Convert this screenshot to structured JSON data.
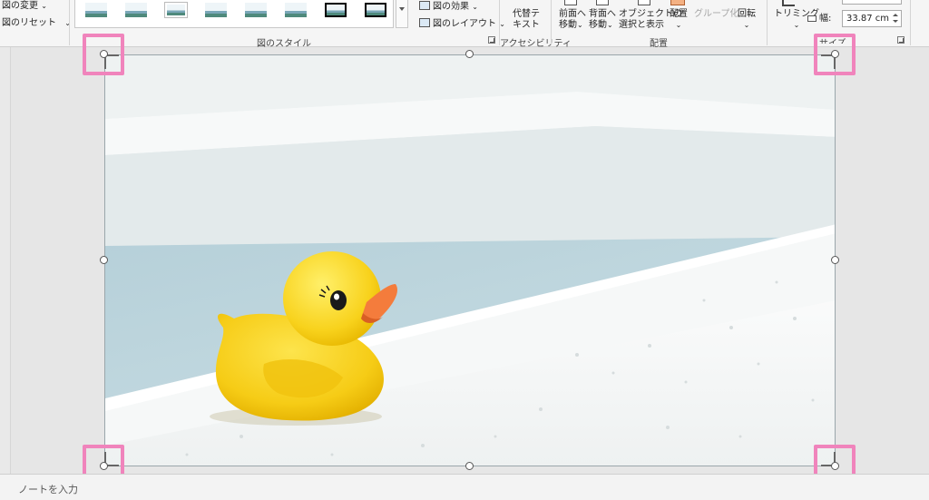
{
  "ribbon": {
    "adjust": {
      "change_picture": "図の変更",
      "reset_picture": "図のリセット"
    },
    "picture_styles": {
      "group_label": "図のスタイル",
      "picture_effects": "図の効果",
      "picture_layout": "図のレイアウト"
    },
    "accessibility": {
      "alt_text_line1": "代替テ",
      "alt_text_line2": "キスト",
      "group_label": "アクセシビリティ"
    },
    "arrange": {
      "bring_forward_line1": "前面へ",
      "bring_forward_line2": "移動",
      "send_backward_line1": "背面へ",
      "send_backward_line2": "移動",
      "selection_pane_line1": "オブジェクトの",
      "selection_pane_line2": "選択と表示",
      "align": "配置",
      "group": "グループ化",
      "rotate": "回転",
      "group_label": "配置"
    },
    "size": {
      "crop": "トリミング",
      "width_label": "幅:",
      "width_value": "33.87 cm",
      "group_label": "サイズ"
    }
  },
  "notes": {
    "placeholder": "ノートを入力"
  },
  "colors": {
    "highlight": "#f084bc",
    "ribbon_bg": "#f5f5f5",
    "duck": "#f8d21c",
    "beak": "#f47c3c"
  }
}
